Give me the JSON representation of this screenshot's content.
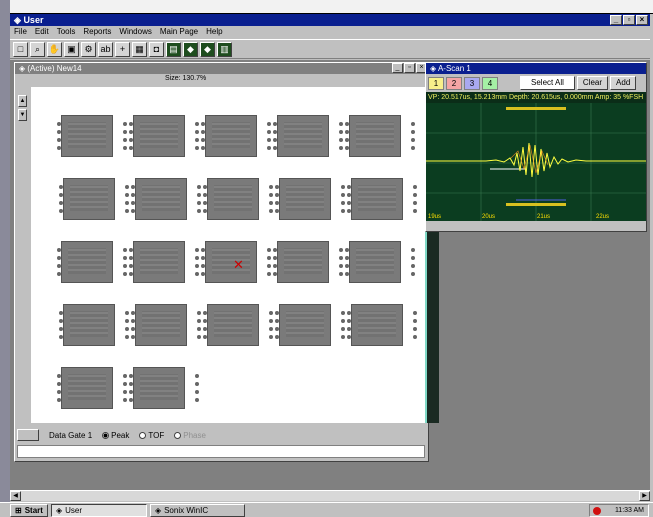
{
  "app": {
    "title": "User",
    "menu": [
      "File",
      "Edit",
      "Tools",
      "Reports",
      "Windows",
      "Main Page",
      "Help"
    ],
    "toolbar_icons": [
      "square-icon",
      "magnify-icon",
      "hand-icon",
      "select-icon",
      "gear-icon",
      "ab-icon",
      "crosshair-icon",
      "save-icon",
      "disk-icon",
      "grid-icon",
      "cube-icon",
      "cube-icon",
      "chart-icon"
    ]
  },
  "cscan": {
    "title": "(Active) New14",
    "size_label": "Size: 130.7%",
    "data_gate_label": "Data Gate 1",
    "radio": {
      "peak": "Peak",
      "tof": "TOF",
      "phase": "Phase"
    },
    "selected_mode": "Peak",
    "chip_rows": [
      5,
      5,
      5,
      5,
      2
    ]
  },
  "ascan": {
    "title": "A-Scan 1",
    "gates": [
      "1",
      "2",
      "3",
      "4"
    ],
    "gate_colors": [
      "#f7f08a",
      "#f4a5a5",
      "#a9a9f0",
      "#a5f0a5"
    ],
    "select_all": "Select All",
    "clear": "Clear",
    "add": "Add",
    "readout": "VP: 20.517us, 15.213mm  Depth: 20.615us, 0.000mm  Amp: 35 %FSH",
    "x_ticks": [
      "19us",
      "20us",
      "21us",
      "22us"
    ],
    "plot_bg": "#0b3d20",
    "trace_color": "#ffff40"
  },
  "taskbar": {
    "start": "Start",
    "tasks": [
      "User",
      "Sonix WinIC"
    ],
    "time": "11:33 AM"
  }
}
